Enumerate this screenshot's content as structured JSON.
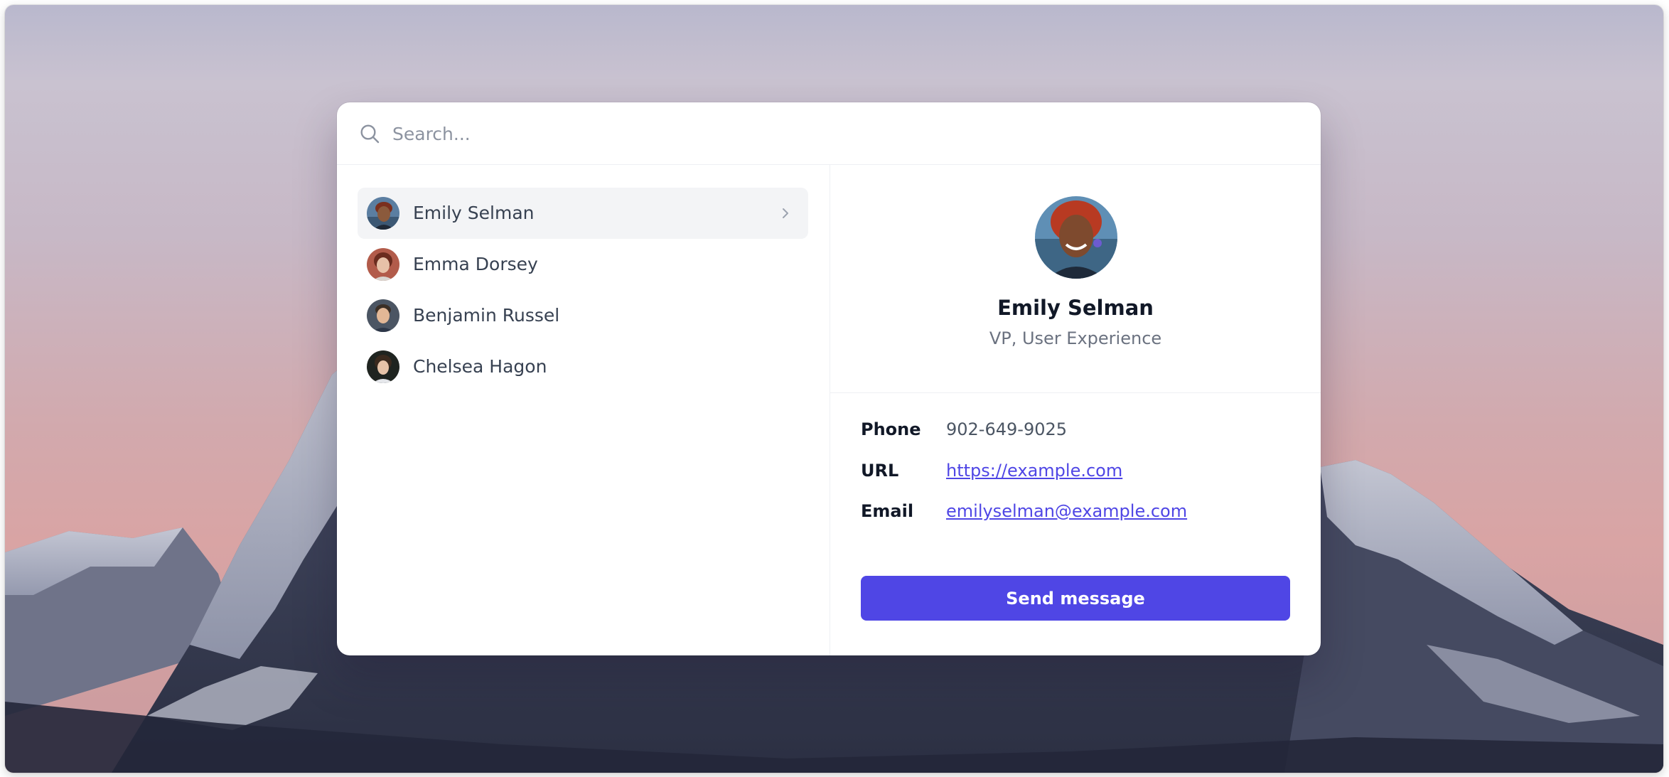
{
  "search": {
    "placeholder": "Search...",
    "icon": "search-icon"
  },
  "people": [
    {
      "name": "Emily Selman",
      "active": true,
      "avatar": "avatar-emily"
    },
    {
      "name": "Emma Dorsey",
      "active": false,
      "avatar": "avatar-emma"
    },
    {
      "name": "Benjamin Russel",
      "active": false,
      "avatar": "avatar-benjamin"
    },
    {
      "name": "Chelsea Hagon",
      "active": false,
      "avatar": "avatar-chelsea"
    }
  ],
  "detail": {
    "name": "Emily Selman",
    "title": "VP, User Experience",
    "fields": [
      {
        "label": "Phone",
        "value": "902-649-9025",
        "link": false
      },
      {
        "label": "URL",
        "value": "https://example.com",
        "link": true
      },
      {
        "label": "Email",
        "value": "emilyselman@example.com",
        "link": true
      }
    ],
    "send_label": "Send message"
  },
  "colors": {
    "accent": "#4f46e5",
    "active_row": "#f3f4f6",
    "text_primary": "#111827",
    "text_secondary": "#6b7280"
  }
}
